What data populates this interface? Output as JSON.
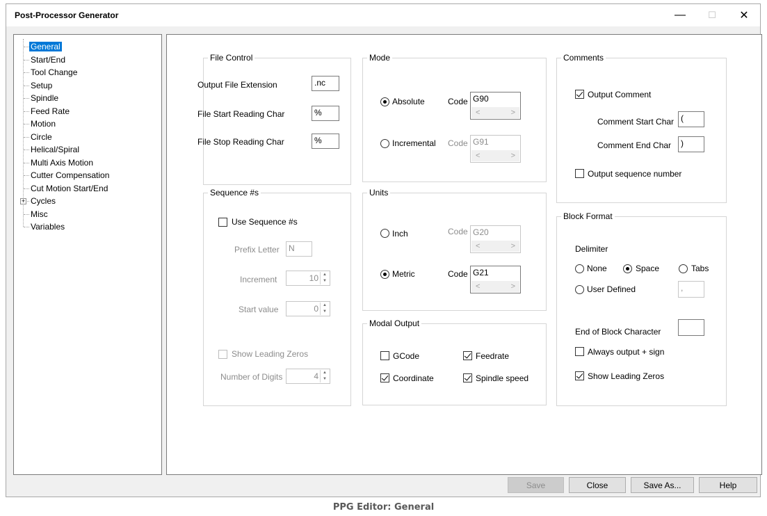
{
  "window": {
    "title": "Post-Processor Generator",
    "minimize_glyph": "—",
    "maximize_glyph": "☐",
    "close_glyph": "✕"
  },
  "tree": {
    "items": [
      {
        "label": "General",
        "selected": true
      },
      {
        "label": "Start/End"
      },
      {
        "label": "Tool Change"
      },
      {
        "label": "Setup"
      },
      {
        "label": "Spindle"
      },
      {
        "label": "Feed Rate"
      },
      {
        "label": "Motion"
      },
      {
        "label": "Circle"
      },
      {
        "label": "Helical/Spiral"
      },
      {
        "label": "Multi Axis Motion"
      },
      {
        "label": "Cutter Compensation"
      },
      {
        "label": "Cut Motion Start/End"
      },
      {
        "label": "Cycles",
        "expandable": true,
        "expand_glyph": "+"
      },
      {
        "label": "Misc"
      },
      {
        "label": "Variables"
      }
    ]
  },
  "file_control": {
    "title": "File Control",
    "output_ext_label": "Output File Extension",
    "output_ext_value": ".nc",
    "start_char_label": "File Start Reading Char",
    "start_char_value": "%",
    "stop_char_label": "File Stop Reading Char",
    "stop_char_value": "%"
  },
  "sequence": {
    "title": "Sequence #s",
    "use_label": "Use Sequence #s",
    "use_checked": false,
    "prefix_label": "Prefix Letter",
    "prefix_value": "N",
    "increment_label": "Increment",
    "increment_value": "10",
    "start_label": "Start value",
    "start_value": "0",
    "leading_zeros_label": "Show Leading Zeros",
    "leading_zeros_checked": false,
    "digits_label": "Number of Digits",
    "digits_value": "4"
  },
  "mode": {
    "title": "Mode",
    "absolute_label": "Absolute",
    "absolute_selected": true,
    "absolute_code_label": "Code",
    "absolute_code": "G90",
    "incremental_label": "Incremental",
    "incremental_code_label": "Code",
    "incremental_code": "G91"
  },
  "units": {
    "title": "Units",
    "inch_label": "Inch",
    "inch_code_label": "Code",
    "inch_code": "G20",
    "metric_label": "Metric",
    "metric_selected": true,
    "metric_code_label": "Code",
    "metric_code": "G21"
  },
  "modal_output": {
    "title": "Modal Output",
    "gcode_label": "GCode",
    "gcode_checked": false,
    "feedrate_label": "Feedrate",
    "feedrate_checked": true,
    "coordinate_label": "Coordinate",
    "coordinate_checked": true,
    "spindle_label": "Spindle speed",
    "spindle_checked": true
  },
  "comments": {
    "title": "Comments",
    "output_comment_label": "Output Comment",
    "output_comment_checked": true,
    "start_char_label": "Comment Start Char",
    "start_char_value": "(",
    "end_char_label": "Comment End Char",
    "end_char_value": ")",
    "seq_num_label": "Output sequence number",
    "seq_num_checked": false
  },
  "block_format": {
    "title": "Block Format",
    "delimiter_label": "Delimiter",
    "none_label": "None",
    "space_label": "Space",
    "space_selected": true,
    "tabs_label": "Tabs",
    "user_defined_label": "User Defined",
    "user_defined_value": ",",
    "eob_label": "End of Block Character",
    "eob_value": "",
    "always_sign_label": "Always output + sign",
    "always_sign_checked": false,
    "leading_zeros_label": "Show Leading Zeros",
    "leading_zeros_checked": true
  },
  "buttons": {
    "save": "Save",
    "close": "Close",
    "save_as": "Save As...",
    "help": "Help"
  },
  "caption": "PPG Editor: General",
  "icons": {
    "spin_up": "▲",
    "spin_down": "▼",
    "scroll_left": "<",
    "scroll_right": ">"
  },
  "colors": {
    "selection": "#0078d7",
    "disabled_text": "#8c8c8c"
  }
}
